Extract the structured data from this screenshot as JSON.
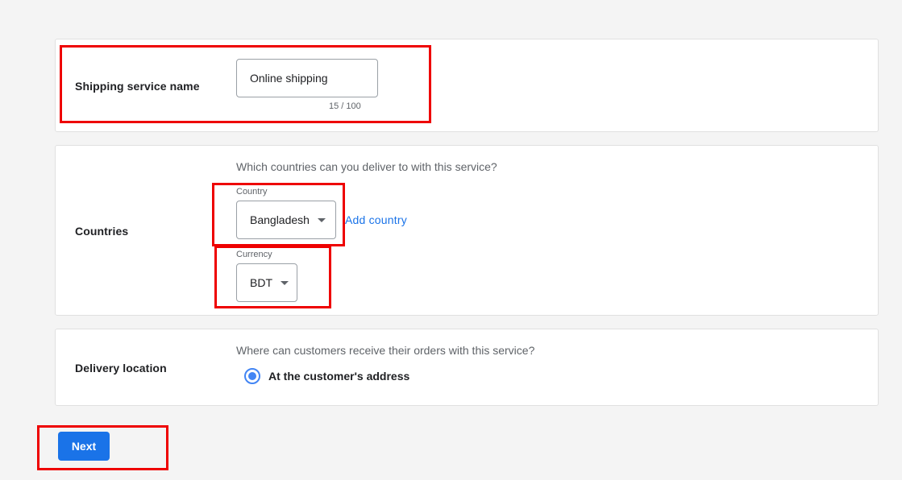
{
  "shipping_name": {
    "label": "Shipping service name",
    "value": "Online shipping",
    "counter": "15 / 100"
  },
  "countries": {
    "label": "Countries",
    "question": "Which countries can you deliver to with this service?",
    "country_field_label": "Country",
    "country_value": "Bangladesh",
    "add_country_label": "Add country",
    "currency_field_label": "Currency",
    "currency_value": "BDT"
  },
  "delivery": {
    "label": "Delivery location",
    "question": "Where can customers receive their orders with this service?",
    "option_label": "At the customer's address",
    "option_selected": true
  },
  "actions": {
    "next_label": "Next"
  },
  "colors": {
    "primary": "#1a73e8",
    "radio": "#4285f4",
    "highlight": "#ee0000"
  }
}
